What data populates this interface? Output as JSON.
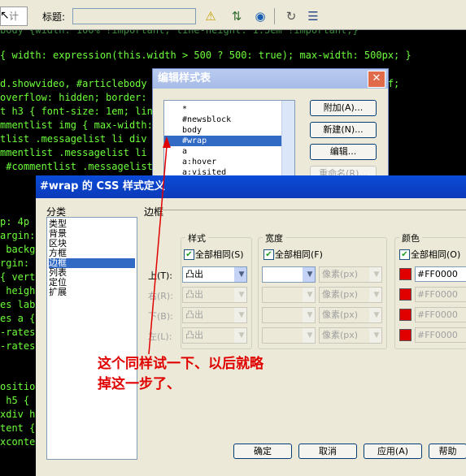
{
  "toolbar": {
    "design_label": "计",
    "title_label": "标题:",
    "title_value": ""
  },
  "code_lines": [
    "body {width: 100% !important; line-height: 1.5em !important;}",
    "{ width: expression(this.width > 500 ? 500: true); max-width: 500px; }",
    "d.showvideo, #articlebody                                sans-serif;",
    "overflow: hidden; border: 1                            : 0 5px; }",
    "t h3 { font-size: 1em; line                     FFF; border-bo",
    "mmentlist img { max-width:                          ? 500: true)",
    "tlist .messagelist li div                      dden; text-ali",
    "mmentlist .messagelist li d",
    " #commentlist .messagelist                     iv  div { line",
    "          #",
    "p: 4p",
    "argin:",
    " backg",
    "rgin:",
    "{ vert",
    " heigh",
    "es lab",
    "es a {",
    "-rates",
    "-rates",
    "",
    "ositio",
    " h5 {",
    "xdiv h",
    "tent {",
    "xconte"
  ],
  "edit_dialog": {
    "title": "编辑样式表",
    "items": [
      "*",
      "#newsblock",
      "body",
      "#wrap",
      "a",
      "a:hover",
      "a:visited"
    ],
    "selected": "#wrap",
    "buttons": [
      "附加(A)...",
      "新建(N)...",
      "编辑...",
      "重命名(R)..."
    ]
  },
  "css_dialog": {
    "title": "#wrap 的 CSS 样式定义",
    "category_label": "分类",
    "categories": [
      "类型",
      "背景",
      "区块",
      "方框",
      "边框",
      "列表",
      "定位",
      "扩展"
    ],
    "selected_category": "边框",
    "panel_title": "边框",
    "style_group": "样式",
    "width_group": "宽度",
    "color_group": "颜色",
    "same_all_style": "全部相同(S)",
    "same_all_width": "全部相同(F)",
    "same_all_color": "全部相同(O)",
    "sides": [
      "上(T):",
      "右(R):",
      "下(B):",
      "左(L):"
    ],
    "style_values": [
      "凸出",
      "凸出",
      "凸出",
      "凸出"
    ],
    "width_values": [
      "",
      "",
      "",
      ""
    ],
    "unit_values": [
      "像素(px)",
      "像素(px)",
      "像素(px)",
      "像素(px)"
    ],
    "color_values": [
      "#FF0000",
      "#FF0000",
      "#FF0000",
      "#FF0000"
    ],
    "buttons": [
      "确定",
      "取消",
      "应用(A)",
      "帮助"
    ]
  },
  "annotation": {
    "line1": "这个同样试一下、以后就略",
    "line2": "掉这一步了、"
  },
  "colors": {
    "code_text": "#6dff3a",
    "annotation_red": "#e00000",
    "selection_blue": "#316ac5",
    "title_bar_blue": "#0a4bd8"
  }
}
